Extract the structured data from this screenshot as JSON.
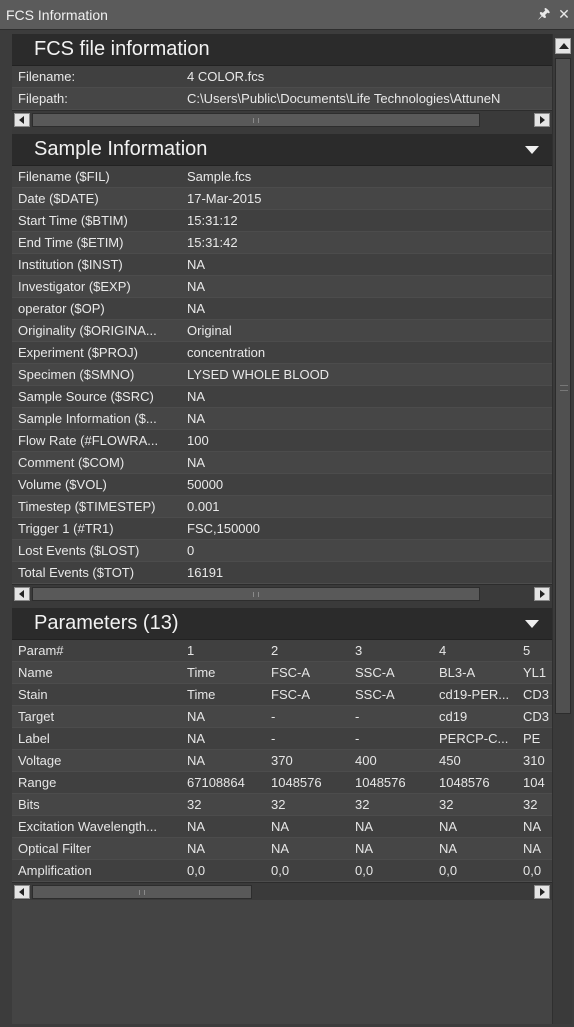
{
  "window": {
    "title": "FCS Information",
    "pin_glyph": "↕",
    "close_glyph": "✕"
  },
  "file_info": {
    "header": "FCS file information",
    "rows": [
      {
        "key": "Filename:",
        "value": "4 COLOR.fcs"
      },
      {
        "key": "Filepath:",
        "value": "C:\\Users\\Public\\Documents\\Life Technologies\\AttuneN"
      }
    ]
  },
  "sample_info": {
    "header": "Sample Information",
    "rows": [
      {
        "key": "Filename ($FIL)",
        "value": "Sample.fcs"
      },
      {
        "key": "Date ($DATE)",
        "value": "17-Mar-2015"
      },
      {
        "key": "Start Time ($BTIM)",
        "value": "15:31:12"
      },
      {
        "key": "End Time ($ETIM)",
        "value": "15:31:42"
      },
      {
        "key": "Institution ($INST)",
        "value": "NA"
      },
      {
        "key": "Investigator ($EXP)",
        "value": "NA"
      },
      {
        "key": "operator ($OP)",
        "value": "NA"
      },
      {
        "key": "Originality ($ORIGINA...",
        "value": "Original"
      },
      {
        "key": "Experiment ($PROJ)",
        "value": "concentration"
      },
      {
        "key": "Specimen ($SMNO)",
        "value": "LYSED WHOLE BLOOD"
      },
      {
        "key": "Sample Source ($SRC)",
        "value": "NA"
      },
      {
        "key": "Sample Information ($...",
        "value": "NA"
      },
      {
        "key": "Flow Rate (#FLOWRA...",
        "value": "100"
      },
      {
        "key": "Comment ($COM)",
        "value": "NA"
      },
      {
        "key": "Volume ($VOL)",
        "value": "50000"
      },
      {
        "key": "Timestep ($TIMESTEP)",
        "value": "0.001"
      },
      {
        "key": "Trigger 1 (#TR1)",
        "value": "FSC,150000"
      },
      {
        "key": "Lost Events ($LOST)",
        "value": "0"
      },
      {
        "key": "Total Events ($TOT)",
        "value": "16191"
      }
    ]
  },
  "parameters": {
    "header": "Parameters (13)",
    "rows": [
      {
        "key": "Param#",
        "cells": [
          "1",
          "2",
          "3",
          "4",
          "5"
        ]
      },
      {
        "key": "Name",
        "cells": [
          "Time",
          "FSC-A",
          "SSC-A",
          "BL3-A",
          "YL1"
        ]
      },
      {
        "key": "Stain",
        "cells": [
          "Time",
          "FSC-A",
          "SSC-A",
          "cd19-PER...",
          "CD3"
        ]
      },
      {
        "key": "Target",
        "cells": [
          "NA",
          "-",
          "-",
          "cd19",
          "CD3"
        ]
      },
      {
        "key": "Label",
        "cells": [
          "NA",
          "-",
          "-",
          "PERCP-C...",
          "PE"
        ]
      },
      {
        "key": "Voltage",
        "cells": [
          "NA",
          "370",
          "400",
          "450",
          "310"
        ]
      },
      {
        "key": "Range",
        "cells": [
          "67108864",
          "1048576",
          "1048576",
          "1048576",
          "104"
        ]
      },
      {
        "key": "Bits",
        "cells": [
          "32",
          "32",
          "32",
          "32",
          "32"
        ]
      },
      {
        "key": "Excitation Wavelength...",
        "cells": [
          "NA",
          "NA",
          "NA",
          "NA",
          "NA"
        ]
      },
      {
        "key": "Optical Filter",
        "cells": [
          "NA",
          "NA",
          "NA",
          "NA",
          "NA"
        ]
      },
      {
        "key": "Amplification",
        "cells": [
          "0,0",
          "0,0",
          "0,0",
          "0,0",
          "0,0"
        ]
      }
    ]
  }
}
